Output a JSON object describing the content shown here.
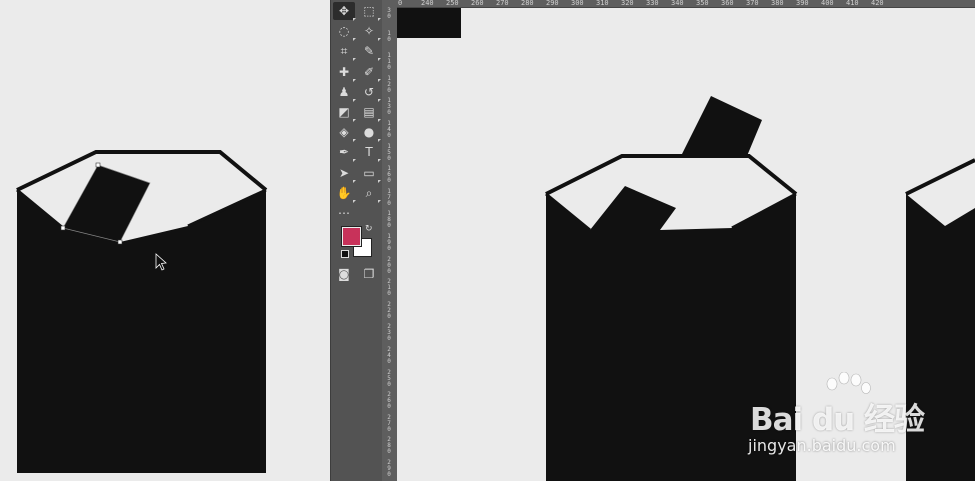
{
  "toolbar": {
    "tools": [
      {
        "id": "move",
        "icon": "move-icon",
        "glyph": "✥",
        "active": true
      },
      {
        "id": "marquee",
        "icon": "rect-marquee-icon",
        "glyph": "⬚"
      },
      {
        "id": "lasso",
        "icon": "lasso-icon",
        "glyph": "◌"
      },
      {
        "id": "magic-wand",
        "icon": "magic-wand-icon",
        "glyph": "✧"
      },
      {
        "id": "crop",
        "icon": "crop-icon",
        "glyph": "⌗"
      },
      {
        "id": "eyedropper",
        "icon": "eyedropper-icon",
        "glyph": "✎"
      },
      {
        "id": "healing",
        "icon": "healing-brush-icon",
        "glyph": "✚"
      },
      {
        "id": "brush",
        "icon": "brush-icon",
        "glyph": "✐"
      },
      {
        "id": "stamp",
        "icon": "clone-stamp-icon",
        "glyph": "♟"
      },
      {
        "id": "history-brush",
        "icon": "history-brush-icon",
        "glyph": "↺"
      },
      {
        "id": "eraser",
        "icon": "eraser-icon",
        "glyph": "◩"
      },
      {
        "id": "gradient",
        "icon": "gradient-icon",
        "glyph": "▤"
      },
      {
        "id": "blur",
        "icon": "blur-icon",
        "glyph": "◈"
      },
      {
        "id": "dodge",
        "icon": "dodge-icon",
        "glyph": "●"
      },
      {
        "id": "pen",
        "icon": "pen-icon",
        "glyph": "✒"
      },
      {
        "id": "type",
        "icon": "type-icon",
        "glyph": "T"
      },
      {
        "id": "path-select",
        "icon": "path-selection-icon",
        "glyph": "➤"
      },
      {
        "id": "shape",
        "icon": "rectangle-shape-icon",
        "glyph": "▭"
      },
      {
        "id": "hand",
        "icon": "hand-icon",
        "glyph": "✋"
      },
      {
        "id": "zoom",
        "icon": "zoom-icon",
        "glyph": "⌕"
      },
      {
        "id": "more",
        "icon": "more-tools-icon",
        "glyph": "⋯"
      }
    ],
    "foreground_color": "#c8325a",
    "background_color": "#ffffff",
    "bottom": [
      {
        "id": "quick-mask",
        "icon": "quick-mask-icon",
        "glyph": "◙"
      },
      {
        "id": "screen-mode",
        "icon": "screen-mode-icon",
        "glyph": "❐"
      }
    ]
  },
  "ruler_top": [
    "0",
    "240",
    "250",
    "260",
    "270",
    "280",
    "290",
    "300",
    "310",
    "320",
    "330",
    "340",
    "350",
    "360",
    "370",
    "380",
    "390",
    "400",
    "410",
    "420"
  ],
  "ruler_left": [
    "3 0",
    "1 0",
    "1 1 0",
    "1 2 0",
    "1 3 0",
    "1 4 0",
    "1 5 0",
    "1 6 0",
    "1 7 0",
    "1 8 0",
    "1 9 0",
    "2 0 0",
    "2 1 0",
    "2 2 0",
    "2 3 0",
    "2 4 0",
    "2 5 0",
    "2 6 0",
    "2 7 0",
    "2 8 0",
    "2 9 0"
  ],
  "colors": {
    "shape": "#111111",
    "canvas": "#ebebeb",
    "panel": "#535353"
  },
  "watermark": {
    "brand": "Bai du 经验",
    "url": "jingyan.baidu.com"
  }
}
